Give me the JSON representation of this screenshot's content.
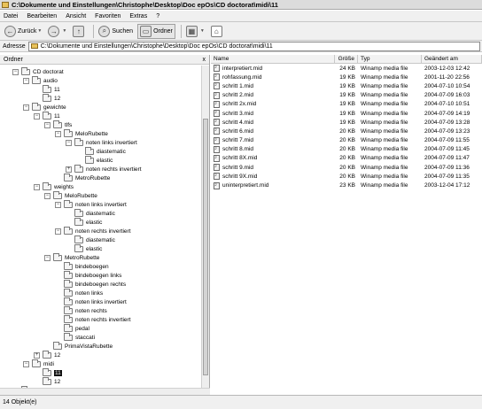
{
  "window": {
    "title": "C:\\Dokumente und Einstellungen\\Christophe\\Desktop\\Doc epOs\\CD doctorat\\midi\\11"
  },
  "menu": [
    "Datei",
    "Bearbeiten",
    "Ansicht",
    "Favoriten",
    "Extras",
    "?"
  ],
  "toolbar": {
    "back_label": "Zurück",
    "search_label": "Suchen",
    "folders_label": "Ordner"
  },
  "address": {
    "label": "Adresse",
    "value": "C:\\Dokumente und Einstellungen\\Christophe\\Desktop\\Doc epOs\\CD doctorat\\midi\\11"
  },
  "folders_pane": {
    "title": "Ordner",
    "close": "x"
  },
  "tree": [
    {
      "label": "CD doctorat",
      "exp": "−"
    },
    {
      "label": "audio",
      "exp": "−"
    },
    {
      "label": "11",
      "exp": ""
    },
    {
      "label": "12",
      "exp": ""
    },
    {
      "label": "gewichte",
      "exp": "−"
    },
    {
      "label": "11",
      "exp": "−"
    },
    {
      "label": "tlfs",
      "exp": "−"
    },
    {
      "label": "MeloRubette",
      "exp": "−"
    },
    {
      "label": "noten links invertiert",
      "exp": "−"
    },
    {
      "label": "diastematic",
      "exp": ""
    },
    {
      "label": "elastic",
      "exp": ""
    },
    {
      "label": "noten rechts invertiert",
      "exp": "+"
    },
    {
      "label": "MetroRubette",
      "exp": ""
    },
    {
      "label": "weights",
      "exp": "−"
    },
    {
      "label": "MeloRubette",
      "exp": "−"
    },
    {
      "label": "noten links invertiert",
      "exp": "−"
    },
    {
      "label": "diastematic",
      "exp": ""
    },
    {
      "label": "elastic",
      "exp": ""
    },
    {
      "label": "noten rechts invertiert",
      "exp": "−"
    },
    {
      "label": "diastematic",
      "exp": ""
    },
    {
      "label": "elastic",
      "exp": ""
    },
    {
      "label": "MetroRubette",
      "exp": "−"
    },
    {
      "label": "bindeboegen",
      "exp": ""
    },
    {
      "label": "bindeboegen links",
      "exp": ""
    },
    {
      "label": "bindeboegen rechts",
      "exp": ""
    },
    {
      "label": "noten links",
      "exp": ""
    },
    {
      "label": "noten links invertiert",
      "exp": ""
    },
    {
      "label": "noten rechts",
      "exp": ""
    },
    {
      "label": "noten rechts invertiert",
      "exp": ""
    },
    {
      "label": "pedal",
      "exp": ""
    },
    {
      "label": "staccati",
      "exp": ""
    },
    {
      "label": "PrimaVistaRubette",
      "exp": ""
    },
    {
      "label": "12",
      "exp": "+"
    },
    {
      "label": "midi",
      "exp": "−"
    },
    {
      "label": "11",
      "exp": "",
      "selected": true
    },
    {
      "label": "12",
      "exp": ""
    },
    {
      "label": "Documents",
      "exp": "+"
    }
  ],
  "file_list": {
    "headers": {
      "name": "Name",
      "size": "Größe",
      "type": "Typ",
      "date": "Geändert am"
    },
    "rows": [
      {
        "name": "interpretiert.mid",
        "size": "24 KB",
        "type": "Winamp media file",
        "date": "2003-12-03 12:42"
      },
      {
        "name": "rohfassung.mid",
        "size": "19 KB",
        "type": "Winamp media file",
        "date": "2001-11-20 22:56"
      },
      {
        "name": "schritt 1.mid",
        "size": "19 KB",
        "type": "Winamp media file",
        "date": "2004-07-10 10:54"
      },
      {
        "name": "schritt 2.mid",
        "size": "19 KB",
        "type": "Winamp media file",
        "date": "2004-07-09 16:03"
      },
      {
        "name": "schritt 2x.mid",
        "size": "19 KB",
        "type": "Winamp media file",
        "date": "2004-07-10 10:51"
      },
      {
        "name": "schritt 3.mid",
        "size": "19 KB",
        "type": "Winamp media file",
        "date": "2004-07-09 14:19"
      },
      {
        "name": "schritt 4.mid",
        "size": "19 KB",
        "type": "Winamp media file",
        "date": "2004-07-09 13:28"
      },
      {
        "name": "schritt 6.mid",
        "size": "20 KB",
        "type": "Winamp media file",
        "date": "2004-07-09 13:23"
      },
      {
        "name": "schritt 7.mid",
        "size": "20 KB",
        "type": "Winamp media file",
        "date": "2004-07-09 11:55"
      },
      {
        "name": "schritt 8.mid",
        "size": "20 KB",
        "type": "Winamp media file",
        "date": "2004-07-09 11:45"
      },
      {
        "name": "schritt 8X.mid",
        "size": "20 KB",
        "type": "Winamp media file",
        "date": "2004-07-09 11:47"
      },
      {
        "name": "schritt 9.mid",
        "size": "20 KB",
        "type": "Winamp media file",
        "date": "2004-07-09 11:36"
      },
      {
        "name": "schritt 9X.mid",
        "size": "20 KB",
        "type": "Winamp media file",
        "date": "2004-07-09 11:35"
      },
      {
        "name": "uninterpretiert.mid",
        "size": "23 KB",
        "type": "Winamp media file",
        "date": "2003-12-04 17:12"
      }
    ]
  },
  "status": {
    "text": "14 Objekt(e)"
  }
}
